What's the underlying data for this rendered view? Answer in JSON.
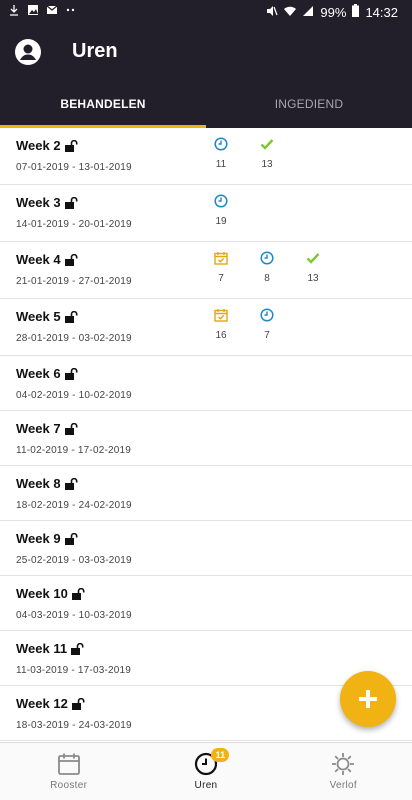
{
  "status_bar": {
    "battery": "99%",
    "time": "14:32"
  },
  "app_bar": {
    "title": "Uren"
  },
  "tabs": [
    {
      "label": "BEHANDELEN",
      "active": true
    },
    {
      "label": "INGEDIEND",
      "active": false
    }
  ],
  "weeks": [
    {
      "title": "Week 2",
      "dates": "07-01-2019 - 13-01-2019",
      "planned": null,
      "hours": "11",
      "approved": "13"
    },
    {
      "title": "Week 3",
      "dates": "14-01-2019 - 20-01-2019",
      "planned": null,
      "hours": "19",
      "approved": null
    },
    {
      "title": "Week 4",
      "dates": "21-01-2019 - 27-01-2019",
      "planned": "7",
      "hours": "8",
      "approved": "13"
    },
    {
      "title": "Week 5",
      "dates": "28-01-2019 - 03-02-2019",
      "planned": "16",
      "hours": "7",
      "approved": null
    },
    {
      "title": "Week 6",
      "dates": "04-02-2019 - 10-02-2019",
      "planned": null,
      "hours": null,
      "approved": null
    },
    {
      "title": "Week 7",
      "dates": "11-02-2019 - 17-02-2019",
      "planned": null,
      "hours": null,
      "approved": null
    },
    {
      "title": "Week 8",
      "dates": "18-02-2019 - 24-02-2019",
      "planned": null,
      "hours": null,
      "approved": null
    },
    {
      "title": "Week 9",
      "dates": "25-02-2019 - 03-03-2019",
      "planned": null,
      "hours": null,
      "approved": null
    },
    {
      "title": "Week 10",
      "dates": "04-03-2019 - 10-03-2019",
      "planned": null,
      "hours": null,
      "approved": null
    },
    {
      "title": "Week 11",
      "dates": "11-03-2019 - 17-03-2019",
      "planned": null,
      "hours": null,
      "approved": null
    },
    {
      "title": "Week 12",
      "dates": "18-03-2019 - 24-03-2019",
      "planned": null,
      "hours": null,
      "approved": null
    }
  ],
  "fab_icon": "plus-icon",
  "bottom_nav": [
    {
      "label": "Rooster",
      "icon": "calendar-icon",
      "active": false
    },
    {
      "label": "Uren",
      "icon": "clock-icon",
      "active": true,
      "badge": "11"
    },
    {
      "label": "Verlof",
      "icon": "sun-icon",
      "active": false
    }
  ],
  "colors": {
    "header_bg": "#221f2b",
    "accent": "#f0b313",
    "hours_icon": "#1e88c7",
    "approved_icon": "#7dc832",
    "planned_icon": "#e2a713"
  }
}
